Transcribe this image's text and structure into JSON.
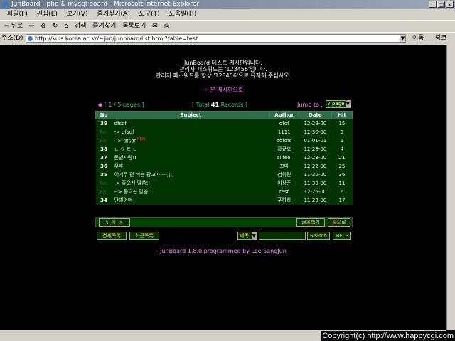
{
  "window": {
    "title": "JunBoard - php & mysql board - Microsoft Internet Explorer",
    "minimize_label": "_",
    "maximize_label": "□",
    "close_label": "x"
  },
  "menu": [
    "파일(F)",
    "편집(E)",
    "보기(V)",
    "즐겨찾기(A)",
    "도구(T)",
    "도움말(H)"
  ],
  "toolbar": {
    "back_label": "뒤로",
    "search_label": "검색",
    "favorites_label": "즐겨찾기",
    "history_label": "목록보기"
  },
  "address": {
    "label": "주소(D)",
    "url": "http://kuls.korea.ac.kr/~jun/junboard/list.html?table=test",
    "go_label": "이동",
    "links_label": "링크"
  },
  "board": {
    "notice_line1": "JunBoard 테스트 게시판입니다.",
    "notice_line2": "관리자 패스워드는 '123456'입니다.",
    "notice_line3": "관리자 패스워드를 항상 '123456'으로 유지해 주십시오.",
    "view_link": "☞ 본 게시판으로",
    "pages": "[ 1 / 5 pages ]",
    "total_prefix": "[ Total ",
    "total_count": "41",
    "total_suffix": " Records ]",
    "jump_label": "Jump to :",
    "jump_value": "? page",
    "columns": [
      "No",
      "Subject",
      "Author",
      "Date",
      "Hit"
    ],
    "rows": [
      {
        "no": "39",
        "subject": "dfsdf",
        "author": "dfdf",
        "date": "12-29-00",
        "hit": "15"
      },
      {
        "no": "Re:",
        "subject": "-> dfsdf",
        "author": "1111",
        "date": "12-30-00",
        "hit": "5"
      },
      {
        "no": "Re:",
        "subject": "--> dfsdf",
        "author": "sdfdfs",
        "date": "01-01-01",
        "hit": "1",
        "new": "NEW"
      },
      {
        "no": "38",
        "subject": "ㄴ ㅇ ㅌ ㄴ",
        "author": "황규호",
        "date": "12-28-00",
        "hit": "4"
      },
      {
        "no": "37",
        "subject": "돈벌사람!!",
        "author": "allfeel",
        "date": "12-23-00",
        "hit": "21"
      },
      {
        "no": "36",
        "subject": "우후",
        "author": "꼬마",
        "date": "12-22-00",
        "hit": "25"
      },
      {
        "no": "35",
        "subject": "여기두 던 버는 광고가 ---;;;;",
        "author": "염휘련",
        "date": "11-30-00",
        "hit": "36"
      },
      {
        "no": "Re:",
        "subject": "-> 좋으신 말씀!!",
        "author": "이상준",
        "date": "11-30-00",
        "hit": "11"
      },
      {
        "no": "Re:",
        "subject": "--> 좋으신 말씀!!",
        "author": "test",
        "date": "12-26-00",
        "hit": "6"
      },
      {
        "no": "34",
        "subject": "단벌어며~",
        "author": "푸하하",
        "date": "11-23-00",
        "hit": "17"
      }
    ],
    "next_label": "뒷 쪽 ->",
    "write_label": "글올리기",
    "home_label": "홈으로",
    "list_all_label": "전체목록",
    "recent_label": "최근목록",
    "search_field": "제목",
    "search_label": "Search",
    "help_label": "HELP",
    "signature": "- JunBoard 1.8.0 programmed by Lee SangJun -"
  },
  "footer": {
    "copyright": "Copyright(c) http://www.happycgi.com"
  },
  "colors": {
    "header_bg": "#2e6f4a",
    "row_bg": "#003300",
    "link": "#ff66ff",
    "accent": "#33cc66"
  }
}
